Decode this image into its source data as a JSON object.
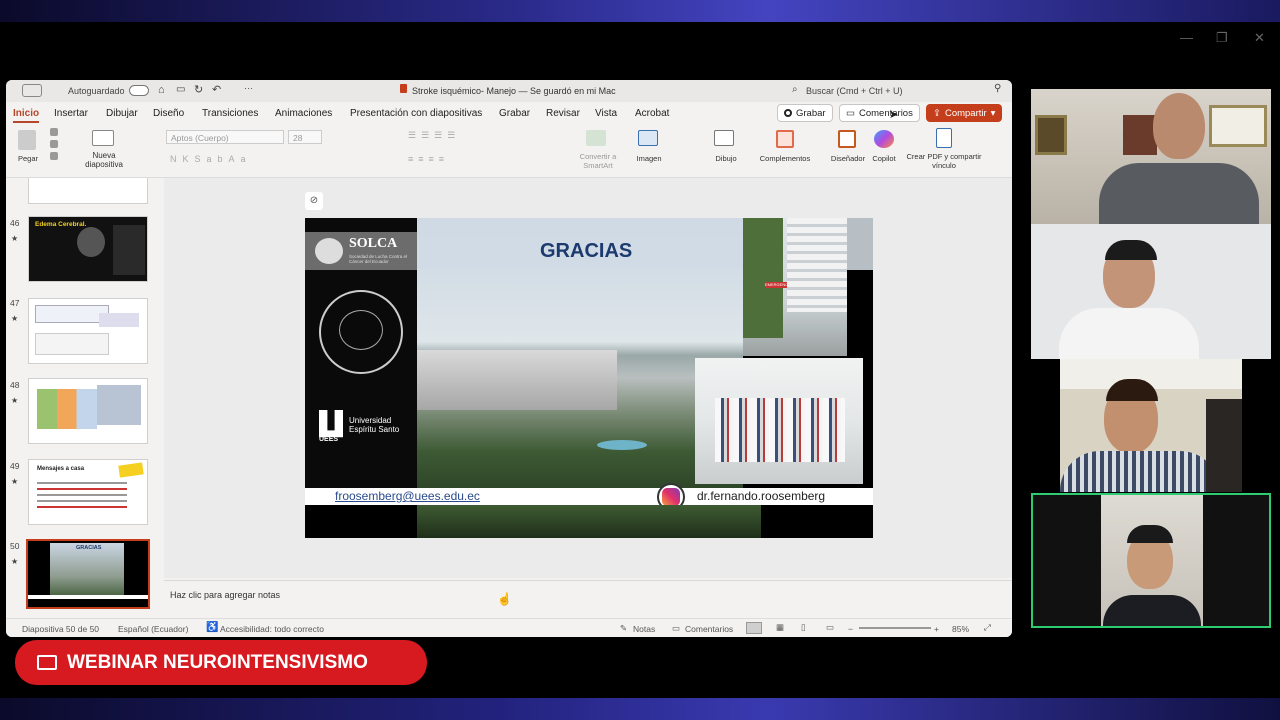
{
  "window": {
    "minimize": "—",
    "restore": "❐",
    "close": "✕"
  },
  "titlebar": {
    "autosave": "Autoguardado",
    "doc_title": "Stroke isquémico- Manejo — Se guardó en mi Mac",
    "search_placeholder": "Buscar (Cmd + Ctrl + U)"
  },
  "tabs": [
    "Inicio",
    "Insertar",
    "Dibujar",
    "Diseño",
    "Transiciones",
    "Animaciones",
    "Presentación con diapositivas",
    "Grabar",
    "Revisar",
    "Vista",
    "Acrobat"
  ],
  "actions": {
    "grabar": "Grabar",
    "comentarios": "Comentarios",
    "compartir": "Compartir"
  },
  "ribbon": {
    "pegar": "Pegar",
    "nueva_diapositiva": "Nueva diapositiva",
    "font_name": "Aptos (Cuerpo)",
    "font_size": "28",
    "convertir": "Convertir a SmartArt",
    "imagen": "Imagen",
    "dibujo": "Dibujo",
    "complementos": "Complementos",
    "disenador": "Diseñador",
    "copilot": "Copilot",
    "crear_pdf": "Crear PDF y compartir vínculo"
  },
  "thumbnails": [
    {
      "num": "46",
      "title": "Edema Cerebral."
    },
    {
      "num": "47",
      "title": ""
    },
    {
      "num": "48",
      "title": ""
    },
    {
      "num": "49",
      "title": "Mensajes a casa"
    },
    {
      "num": "50",
      "title": "GRACIAS"
    }
  ],
  "slide": {
    "title": "GRACIAS",
    "solca": "SOLCA",
    "solca_sub": "Sociedad de Lucha Contra el Cáncer del Ecuador",
    "uees": "UEES",
    "uees_name": "Universidad Espíritu Santo",
    "seal_text": "DIVINA LUX RATIO SALUS SCIENTIAE · MEXICO ·",
    "email": "froosemberg@uees.edu.ec",
    "instagram": "dr.fernando.roosemberg",
    "sign": "EMERGENCIA"
  },
  "notes_placeholder": "Haz clic para agregar notas",
  "status": {
    "slide_count": "Diapositiva 50 de 50",
    "language": "Español (Ecuador)",
    "accessibility": "Accesibilidad: todo correcto",
    "notes": "Notas",
    "comments": "Comentarios",
    "zoom": "85%"
  },
  "banner": {
    "label": "WEBINAR NEUROINTENSIVISMO"
  },
  "colors": {
    "accent": "#c43e1c",
    "banner": "#d71920",
    "active_speaker": "#2ecc71"
  }
}
